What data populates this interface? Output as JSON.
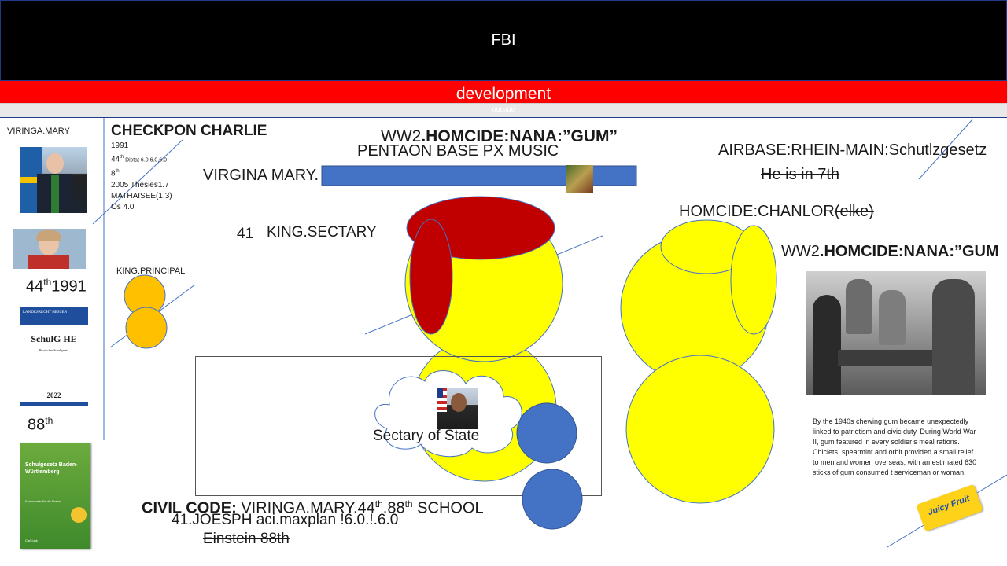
{
  "header": {
    "title": "FBI"
  },
  "banner": {
    "title": "development",
    "subtitle": "outside"
  },
  "left": {
    "name": "VIRINGA.MARY",
    "num44": "44",
    "th": "th",
    "year": "1991",
    "book1": {
      "top": "LANDESRECHT HESSEN",
      "title": "SchulG HE",
      "sub": "Hessisches Schulgesetz",
      "year": "2022"
    },
    "num88": "88",
    "book2": {
      "title": "Schulgesetz Baden-Württemberg",
      "sub": "Kommentar für die Praxis",
      "publisher": "Carl Link"
    }
  },
  "checkpoint": {
    "title": "CHECKPON CHARLIE",
    "l1": "1991",
    "l2a": "44",
    "l2sup": "th",
    "l2b": " Dictat 6.0,6.0,6.0",
    "l3a": "8",
    "l3sup": "th",
    "l4": "2005 Thesies1.7",
    "l5": "MATHAISEE(1.3)",
    "l6": "Os 4.0"
  },
  "king_principal": "KING.PRINCIPAL",
  "ww2_top": {
    "prefix": "WW2",
    "bold": ".HOMCIDE:NANA:”GUM”"
  },
  "pentagon": "PENTAON BASE PX MUSIC",
  "virgina": "VIRGINA MARY.",
  "king_sectary": {
    "num": "41",
    "label": "KING.SECTARY"
  },
  "airbase": "AIRBASE:RHEIN-MAIN:Schutlzgesetz",
  "seventh": "He is in 7th",
  "homcide_chanlor": {
    "label": "HOMCIDE:CHANLOR",
    "struck": "(elke)"
  },
  "ww2_right": {
    "prefix": "WW2",
    "bold": ".HOMCIDE:NANA:”GUM"
  },
  "cloud": "Sectary of State",
  "civil": {
    "bold": "CIVIL CODE:",
    "text": " VIRINGA.MARY.44",
    "sup1": "th",
    "mid": ".88",
    "sup2": "th",
    "end": "  SCHOOL"
  },
  "joesph": {
    "label": "41.JOESPH ",
    "struck": "aci.maxplan !6.0.!.6.0"
  },
  "einstein": "Einstein 88th",
  "gum_text": "By the 1940s chewing gum became unexpectedly linked to patriotism and civic duty. During World War II, gum featured in every soldier’s meal rations. Chiclets, spearmint and orbit provided a small relief to men and women overseas, with an estimated 630 sticks of gum consumed t serviceman or woman.",
  "juicy": "Juicy Fruit",
  "colors": {
    "red": "#ff0000",
    "darkred": "#c00000",
    "yellow": "#ffff00",
    "orange": "#ffc000",
    "blue": "#4472c4"
  }
}
